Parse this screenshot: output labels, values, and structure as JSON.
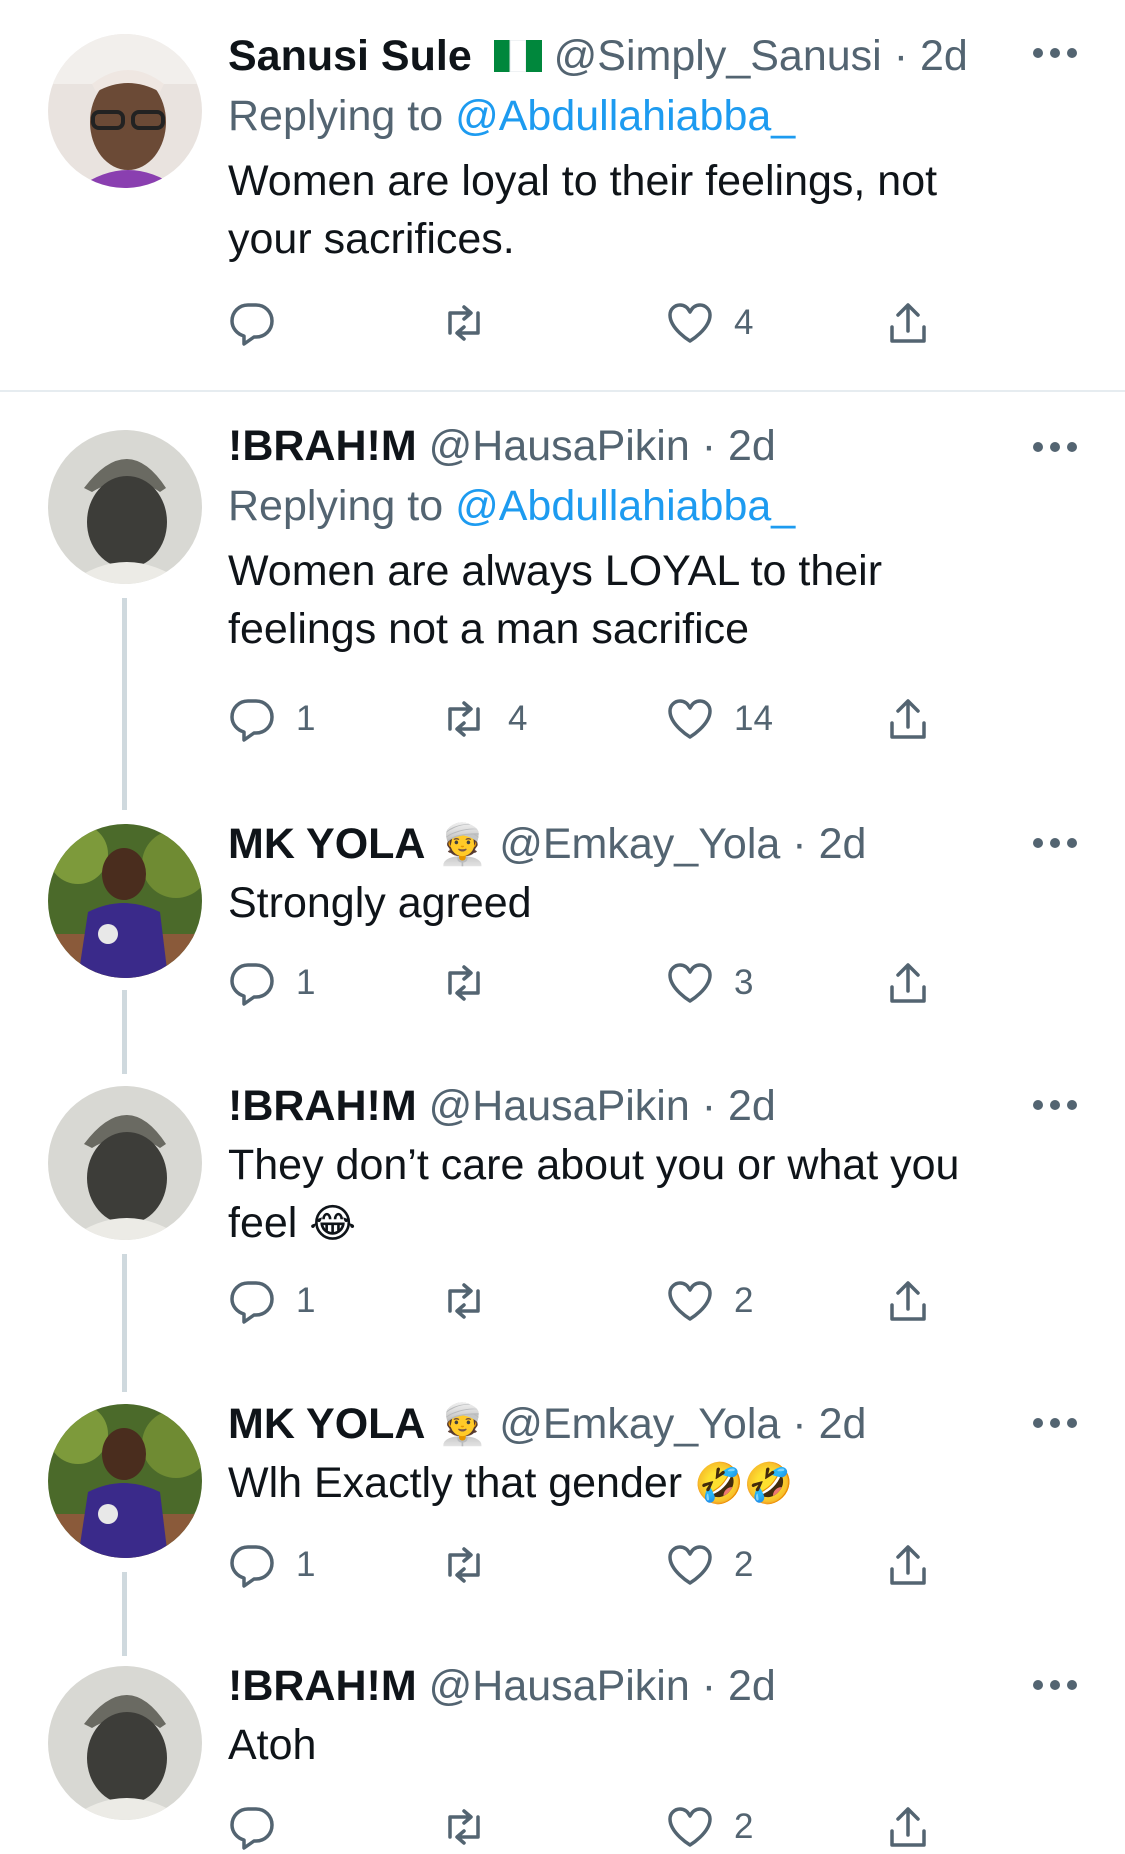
{
  "tweets": [
    {
      "name": "Sanusi Sule",
      "flag": "nigeria-flag",
      "handle": "@Simply_Sanusi",
      "dot": "·",
      "time": "2d",
      "replying_prefix": "Replying to ",
      "replying_handle": "@Abdullahiabba_",
      "lines": [
        "Women are loyal to their feelings, not",
        "your sacrifices."
      ],
      "reply_count": "",
      "retweet_count": "",
      "like_count": "4"
    },
    {
      "name": "!BRAH!M",
      "handle": "@HausaPikin",
      "dot": "·",
      "time": "2d",
      "replying_prefix": "Replying to ",
      "replying_handle": "@Abdullahiabba_",
      "lines": [
        "Women are always LOYAL to their",
        "feelings not a man sacrifice"
      ],
      "reply_count": "1",
      "retweet_count": "4",
      "like_count": "14"
    },
    {
      "name": "MK YOLA",
      "name_emoji": "👳",
      "handle": "@Emkay_Yola",
      "dot": "·",
      "time": "2d",
      "lines": [
        "Strongly agreed"
      ],
      "reply_count": "1",
      "retweet_count": "",
      "like_count": "3"
    },
    {
      "name": "!BRAH!M",
      "handle": "@HausaPikin",
      "dot": "·",
      "time": "2d",
      "lines": [
        "They don’t care about you or what you",
        "feel"
      ],
      "line_emoji": "😂",
      "reply_count": "1",
      "retweet_count": "",
      "like_count": "2"
    },
    {
      "name": "MK YOLA",
      "name_emoji": "👳",
      "handle": "@Emkay_Yola",
      "dot": "·",
      "time": "2d",
      "lines": [
        "Wlh Exactly that gender"
      ],
      "line_emoji": "🤣🤣",
      "reply_count": "1",
      "retweet_count": "",
      "like_count": "2"
    },
    {
      "name": "!BRAH!M",
      "handle": "@HausaPikin",
      "dot": "·",
      "time": "2d",
      "lines": [
        "Atoh"
      ],
      "reply_count": "",
      "retweet_count": "",
      "like_count": "2"
    }
  ],
  "icons": {
    "reply": "reply-icon",
    "retweet": "retweet-icon",
    "like": "heart-icon",
    "share": "share-icon",
    "more": "more-icon"
  },
  "colors": {
    "text": "#0f1419",
    "secondary": "#536471",
    "link": "#1d9bf0",
    "thread_line": "#cfd9de"
  }
}
